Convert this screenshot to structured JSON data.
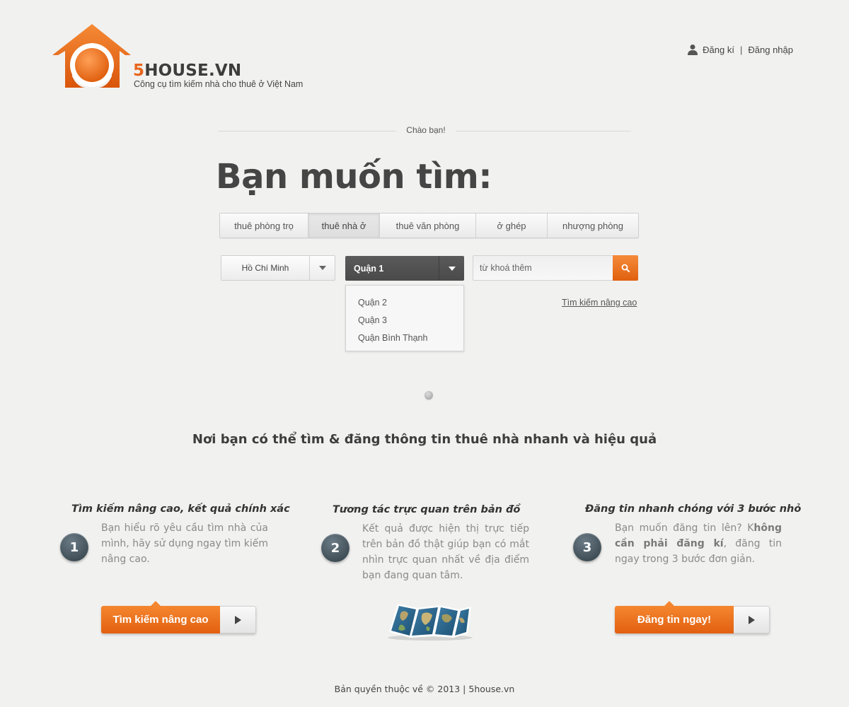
{
  "brand": {
    "name_prefix": "5",
    "name_rest": "HOUSE.VN",
    "tagline": "Công cụ tìm kiếm nhà cho thuê ở Việt Nam",
    "accent_color": "#e8651b"
  },
  "auth": {
    "icon": "user-icon",
    "register": "Đăng kí",
    "separator": "|",
    "login": "Đăng nhập"
  },
  "greeting": "Chào bạn!",
  "headline": "Bạn muốn tìm:",
  "tabs": [
    {
      "label": "thuê phòng trọ",
      "active": false
    },
    {
      "label": "thuê nhà ở",
      "active": true
    },
    {
      "label": "thuê văn phòng",
      "active": false
    },
    {
      "label": "ở ghép",
      "active": false
    },
    {
      "label": "nhượng phòng",
      "active": false
    }
  ],
  "search": {
    "city_value": "Hồ Chí Minh",
    "district_value": "Quận 1",
    "district_options": [
      "Quận 2",
      "Quận 3",
      "Quận Bình Thạnh"
    ],
    "keyword_placeholder": "từ khoá thêm",
    "advanced_link": "Tìm kiếm nâng cao"
  },
  "tagline": "Nơi bạn có thể tìm & đăng thông tin thuê nhà nhanh và hiệu quả",
  "features": [
    {
      "number": "1",
      "title": "Tìm kiếm nâng cao, kết quả chính xác",
      "text": "Bạn hiểu rõ yêu cầu tìm nhà của mình, hãy sử dụng ngay tìm kiếm nâng cao.",
      "button": "Tìm kiếm nâng cao"
    },
    {
      "number": "2",
      "title": "Tương tác trực quan trên bản đồ",
      "text": "Kết quả được hiện thị trực tiếp trên bản đồ thật giúp bạn có mắt nhìn trực quan nhất về địa điểm bạn đang quan tâm.",
      "image": "folded-map-icon"
    },
    {
      "number": "3",
      "title": "Đăng tin nhanh chóng với 3 bước nhỏ",
      "text_before": "Bạn muốn đăng tin lên? K",
      "text_bold": "hông cần phải đăng kí",
      "text_after": ", đăng tin ngay trong 3 bước đơn giản.",
      "button": "Đăng tin ngay!"
    }
  ],
  "footer": "Bản quyền thuộc về © 2013 | 5house.vn"
}
